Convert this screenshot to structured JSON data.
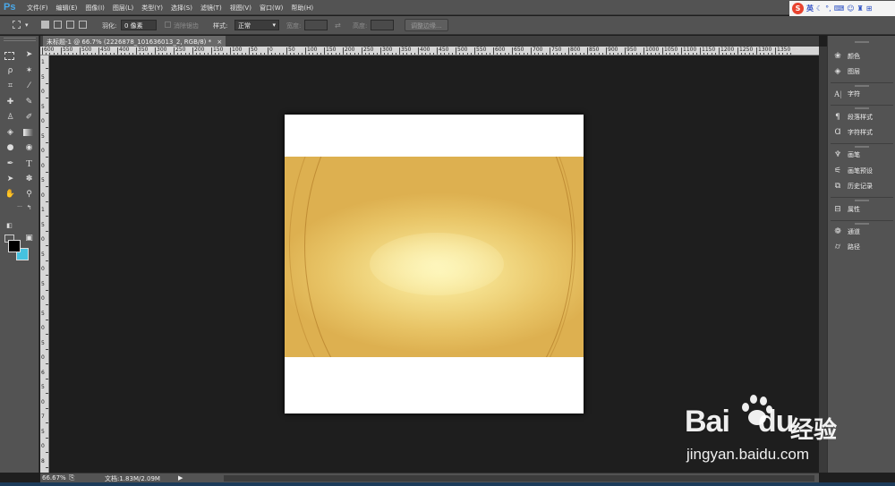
{
  "app": {
    "logo": "Ps",
    "menu": [
      "文件(F)",
      "编辑(E)",
      "图像(I)",
      "图层(L)",
      "类型(Y)",
      "选择(S)",
      "滤镜(T)",
      "视图(V)",
      "窗口(W)",
      "帮助(H)"
    ],
    "window_controls": [
      "-",
      "□",
      "×"
    ]
  },
  "options": {
    "feather_label": "羽化:",
    "feather_value": "0 像素",
    "antialias_label": "消除锯齿",
    "style_label": "样式:",
    "style_value": "正常",
    "width_label": "宽度:",
    "height_label": "高度:",
    "refine_button": "调整边缘..."
  },
  "ime": {
    "badge": "S",
    "mode": "英"
  },
  "document": {
    "tab_title": "未标题-1 @ 66.7% (2226878_101636013_2, RGB/8) *",
    "tab_close": "×"
  },
  "ruler": {
    "top_labels": [
      "600",
      "550",
      "500",
      "450",
      "400",
      "350",
      "300",
      "250",
      "200",
      "150",
      "100",
      "50",
      "0",
      "50",
      "100",
      "150",
      "200",
      "250",
      "300",
      "350",
      "400",
      "450",
      "500",
      "550",
      "600",
      "650",
      "700",
      "750",
      "800",
      "850",
      "900",
      "950",
      "1000",
      "1050",
      "1100",
      "1150",
      "1200",
      "1250",
      "1300",
      "1350"
    ],
    "left_labels": [
      "1",
      "5",
      "0",
      "5",
      "0",
      "5",
      "0",
      "0",
      "5",
      "0",
      "1",
      "5",
      "0",
      "5",
      "0",
      "5",
      "0",
      "5",
      "0",
      "5",
      "0",
      "6",
      "5",
      "0",
      "7",
      "5",
      "0",
      "8"
    ]
  },
  "panels": [
    {
      "icon": "color-icon",
      "label": "颜色"
    },
    {
      "icon": "layers-icon",
      "label": "图层"
    },
    {
      "icon": "character-icon",
      "label": "字符"
    },
    {
      "icon": "paragraph-style-icon",
      "label": "段落样式"
    },
    {
      "icon": "character-style-icon",
      "label": "字符样式"
    },
    {
      "icon": "brush-icon",
      "label": "画笔"
    },
    {
      "icon": "brush-preset-icon",
      "label": "画笔预设"
    },
    {
      "icon": "history-icon",
      "label": "历史记录"
    },
    {
      "icon": "properties-icon",
      "label": "属性"
    },
    {
      "icon": "channels-icon",
      "label": "通道"
    },
    {
      "icon": "paths-icon",
      "label": "路径"
    }
  ],
  "status": {
    "zoom": "66.67%",
    "doc_info": "文档:1.83M/2.09M"
  },
  "watermark": {
    "brand": "Bai",
    "brand_end": "du",
    "product": "经验",
    "url": "jingyan.baidu.com"
  },
  "colors": {
    "foreground": "#000000",
    "background": "#46c2e0",
    "ui_panel": "#535353",
    "workspace": "#1e1e1e"
  }
}
